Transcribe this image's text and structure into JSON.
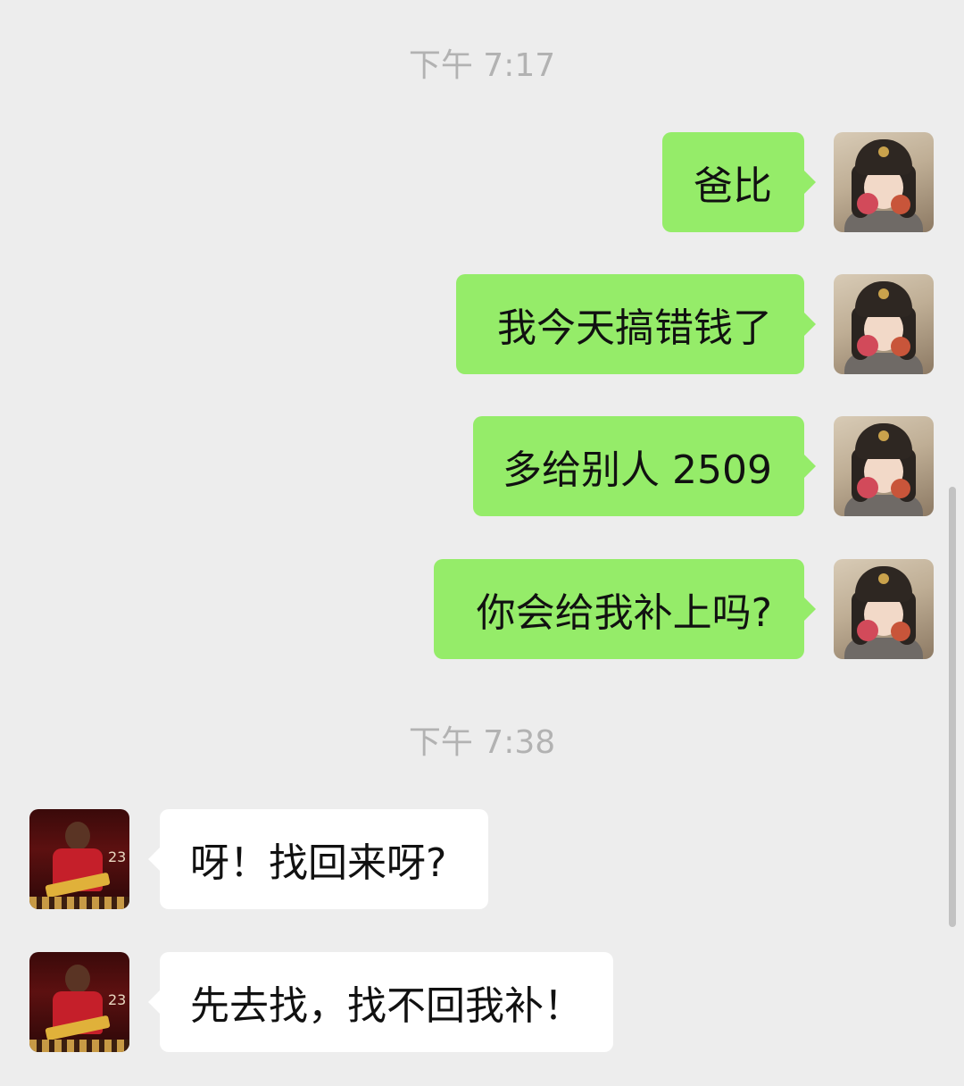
{
  "timestamps": [
    "下午 7:17",
    "下午 7:38"
  ],
  "messages": [
    {
      "sender": "me",
      "text": "爸比"
    },
    {
      "sender": "me",
      "text": "我今天搞错钱了"
    },
    {
      "sender": "me",
      "text": "多给别人 2509"
    },
    {
      "sender": "me",
      "text": "你会给我补上吗?"
    },
    {
      "sender": "other",
      "text": "呀！找回来呀?"
    },
    {
      "sender": "other",
      "text": "先去找，找不回我补！"
    }
  ],
  "colors": {
    "background": "#ededed",
    "outgoing_bubble": "#95ec69",
    "incoming_bubble": "#ffffff",
    "timestamp_text": "#b2b2b2"
  },
  "icons": {
    "my_avatar": "user-photo-avatar-icon",
    "contact_avatar": "basketball-poster-avatar-icon"
  }
}
